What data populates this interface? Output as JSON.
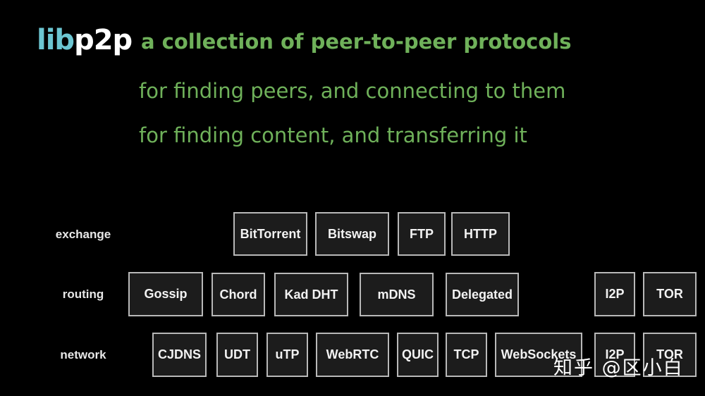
{
  "title": {
    "lib": "lib",
    "p2p": "p2p",
    "subtitle": "a collection of peer-to-peer protocols"
  },
  "lines": [
    "for finding peers, and connecting to them",
    "for finding content, and transferring it"
  ],
  "layers": {
    "exchange": {
      "label": "exchange",
      "items": [
        "BitTorrent",
        "Bitswap",
        "FTP",
        "HTTP"
      ]
    },
    "routing": {
      "label": "routing",
      "items": [
        "Gossip",
        "Chord",
        "Kad DHT",
        "mDNS",
        "Delegated",
        "I2P",
        "TOR"
      ]
    },
    "network": {
      "label": "network",
      "items": [
        "CJDNS",
        "UDT",
        "uTP",
        "WebRTC",
        "QUIC",
        "TCP",
        "WebSockets",
        "I2P",
        "TOR"
      ]
    }
  },
  "watermark": "知乎 @区小白",
  "colors": {
    "accent_blue": "#6cc6d2",
    "accent_green": "#6fb15a",
    "box_border": "#b8b8b8",
    "box_fill": "#1c1c1c"
  }
}
